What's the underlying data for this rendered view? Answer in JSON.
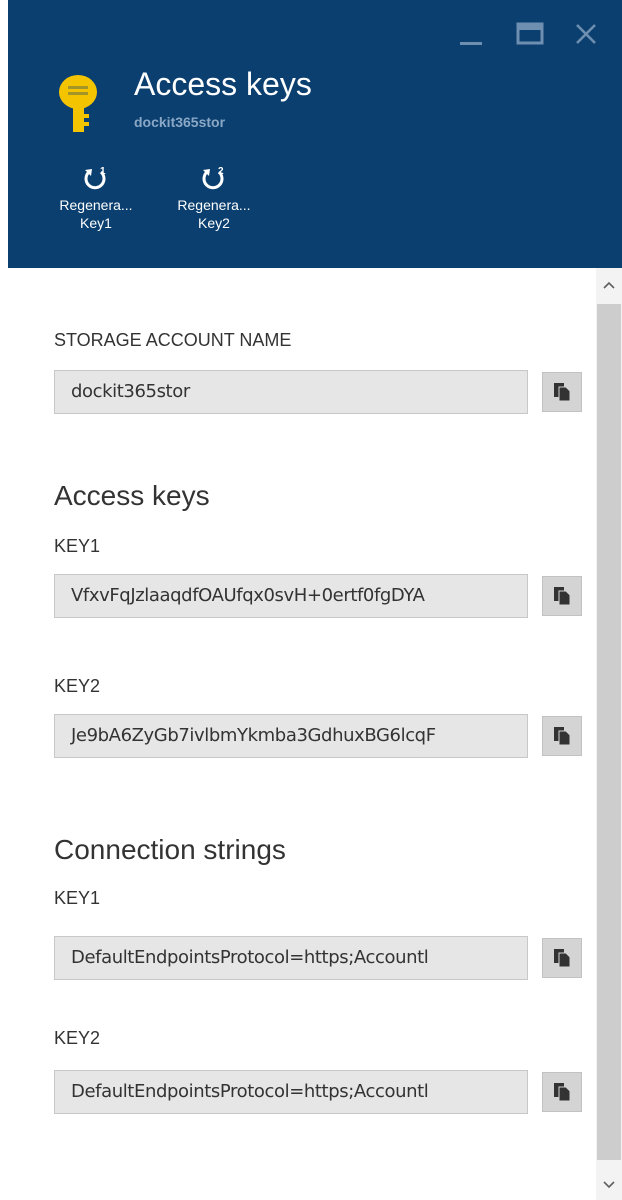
{
  "window": {
    "controls": [
      "minimize-icon",
      "maximize-icon",
      "close-icon"
    ]
  },
  "header": {
    "title": "Access keys",
    "subtitle": "dockit365stor",
    "icon": "key-icon",
    "colors": {
      "background": "#0b3f6f",
      "subtitle": "#8aa8c6",
      "key": "#f5c400"
    }
  },
  "commands": [
    {
      "icon": "regenerate-key1-icon",
      "line1": "Regenera...",
      "line2": "Key1",
      "badge": "1"
    },
    {
      "icon": "regenerate-key2-icon",
      "line1": "Regenera...",
      "line2": "Key2",
      "badge": "2"
    }
  ],
  "storage": {
    "label": "STORAGE ACCOUNT NAME",
    "value": "dockit365stor"
  },
  "access_keys": {
    "heading": "Access keys",
    "key1_label": "KEY1",
    "key1_value": "VfxvFqJzlaaqdfOAUfqx0svH+0ertf0fgDYA",
    "key2_label": "KEY2",
    "key2_value": "Je9bA6ZyGb7ivlbmYkmba3GdhuxBG6lcqF"
  },
  "connection_strings": {
    "heading": "Connection strings",
    "key1_label": "KEY1",
    "key1_value": "DefaultEndpointsProtocol=https;Accountl",
    "key2_label": "KEY2",
    "key2_value": "DefaultEndpointsProtocol=https;Accountl"
  },
  "icons": {
    "copy": "copy-icon",
    "scroll_up": "scroll-up-icon",
    "scroll_down": "scroll-down-icon"
  }
}
